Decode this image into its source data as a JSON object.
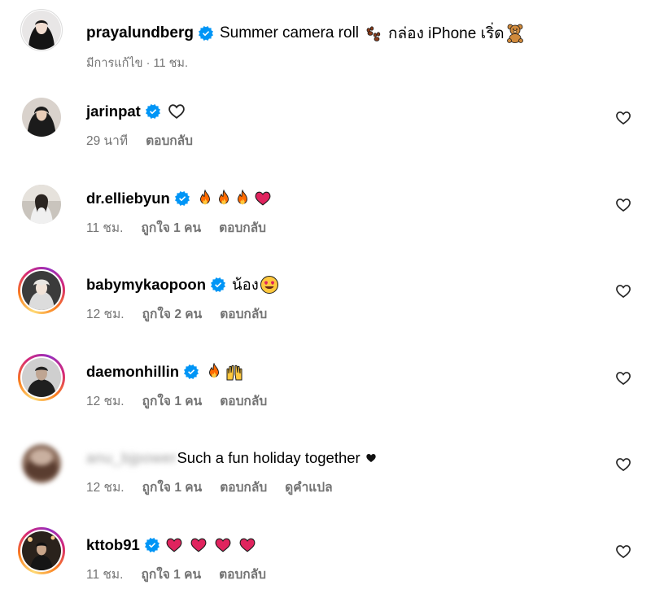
{
  "caption": {
    "username": "prayalundberg",
    "text_before": "Summer camera roll",
    "text_after": "กล่อง iPhone เริ่ด",
    "meta": "มีการแก้ไข · 11 ชม.",
    "icons": [
      "paw-prints-emoji",
      "teddy-bear-emoji"
    ]
  },
  "comments": [
    {
      "username": "jarinpat",
      "verified": true,
      "text": "",
      "reaction": "white-heart",
      "time": "29 นาที",
      "likes": "",
      "reply": "ตอบกลับ",
      "translate": ""
    },
    {
      "username": "dr.elliebyun",
      "verified": true,
      "text": "",
      "reaction": "3x fire, red-heart",
      "time": "11 ชม.",
      "likes": "ถูกใจ 1 คน",
      "reply": "ตอบกลับ",
      "translate": ""
    },
    {
      "username": "babymykaopoon",
      "verified": true,
      "text": "น้อง",
      "reaction": "heart-eyes",
      "time": "12 ชม.",
      "likes": "ถูกใจ 2 คน",
      "reply": "ตอบกลับ",
      "translate": ""
    },
    {
      "username": "daemonhillin",
      "verified": true,
      "text": "",
      "reaction": "fire, raised-hands",
      "time": "12 ชม.",
      "likes": "ถูกใจ 1 คน",
      "reply": "ตอบกลับ",
      "translate": ""
    },
    {
      "username": "anu_bjpower",
      "verified": false,
      "text": "Such a fun holiday together",
      "reaction": "black-heart",
      "time": "12 ชม.",
      "likes": "ถูกใจ 1 คน",
      "reply": "ตอบกลับ",
      "translate": "ดูคำแปล"
    },
    {
      "username": "kttob91",
      "verified": true,
      "text": "",
      "reaction": "4x red-heart",
      "time": "11 ชม.",
      "likes": "ถูกใจ 1 คน",
      "reply": "ตอบกลับ",
      "translate": ""
    }
  ],
  "colors": {
    "verified_blue": "#0095f6",
    "meta_gray": "#737373",
    "heart_red": "#e0245e"
  }
}
